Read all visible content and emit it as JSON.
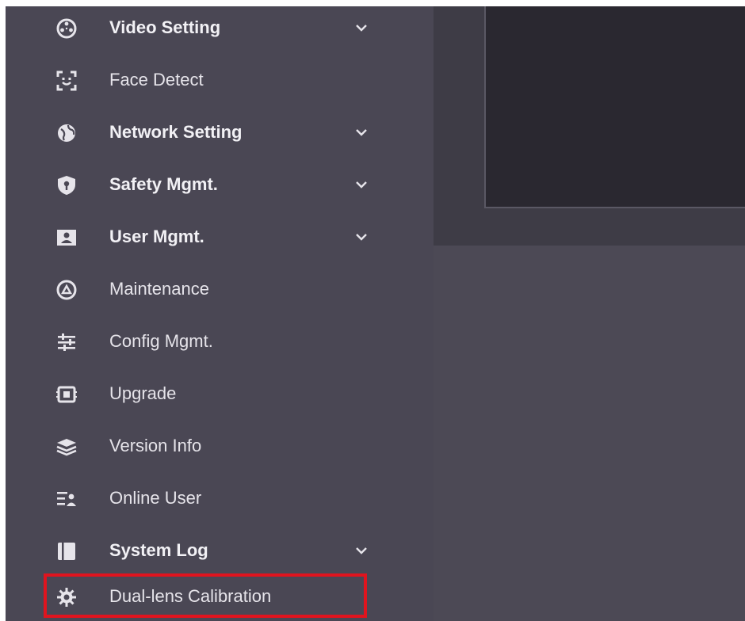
{
  "sidebar": {
    "items": [
      {
        "label": "Video Setting",
        "icon": "video-reel-icon",
        "bold": true,
        "expandable": true
      },
      {
        "label": "Face Detect",
        "icon": "face-scan-icon",
        "bold": false,
        "expandable": false
      },
      {
        "label": "Network Setting",
        "icon": "globe-icon",
        "bold": true,
        "expandable": true
      },
      {
        "label": "Safety Mgmt.",
        "icon": "shield-icon",
        "bold": true,
        "expandable": true
      },
      {
        "label": "User Mgmt.",
        "icon": "user-card-icon",
        "bold": true,
        "expandable": true
      },
      {
        "label": "Maintenance",
        "icon": "gauge-icon",
        "bold": false,
        "expandable": false
      },
      {
        "label": "Config Mgmt.",
        "icon": "sliders-icon",
        "bold": false,
        "expandable": false
      },
      {
        "label": "Upgrade",
        "icon": "chip-icon",
        "bold": false,
        "expandable": false
      },
      {
        "label": "Version Info",
        "icon": "layers-icon",
        "bold": false,
        "expandable": false
      },
      {
        "label": "Online User",
        "icon": "online-user-icon",
        "bold": false,
        "expandable": false
      },
      {
        "label": "System Log",
        "icon": "log-book-icon",
        "bold": true,
        "expandable": true
      },
      {
        "label": "Dual-lens Calibration",
        "icon": "gear-icon",
        "bold": false,
        "expandable": false,
        "highlighted": true
      }
    ]
  },
  "colors": {
    "sidebar_bg": "#4a4754",
    "text": "#e6e4ea",
    "highlight_border": "#e0141e",
    "preview_bg": "#2a2830"
  }
}
